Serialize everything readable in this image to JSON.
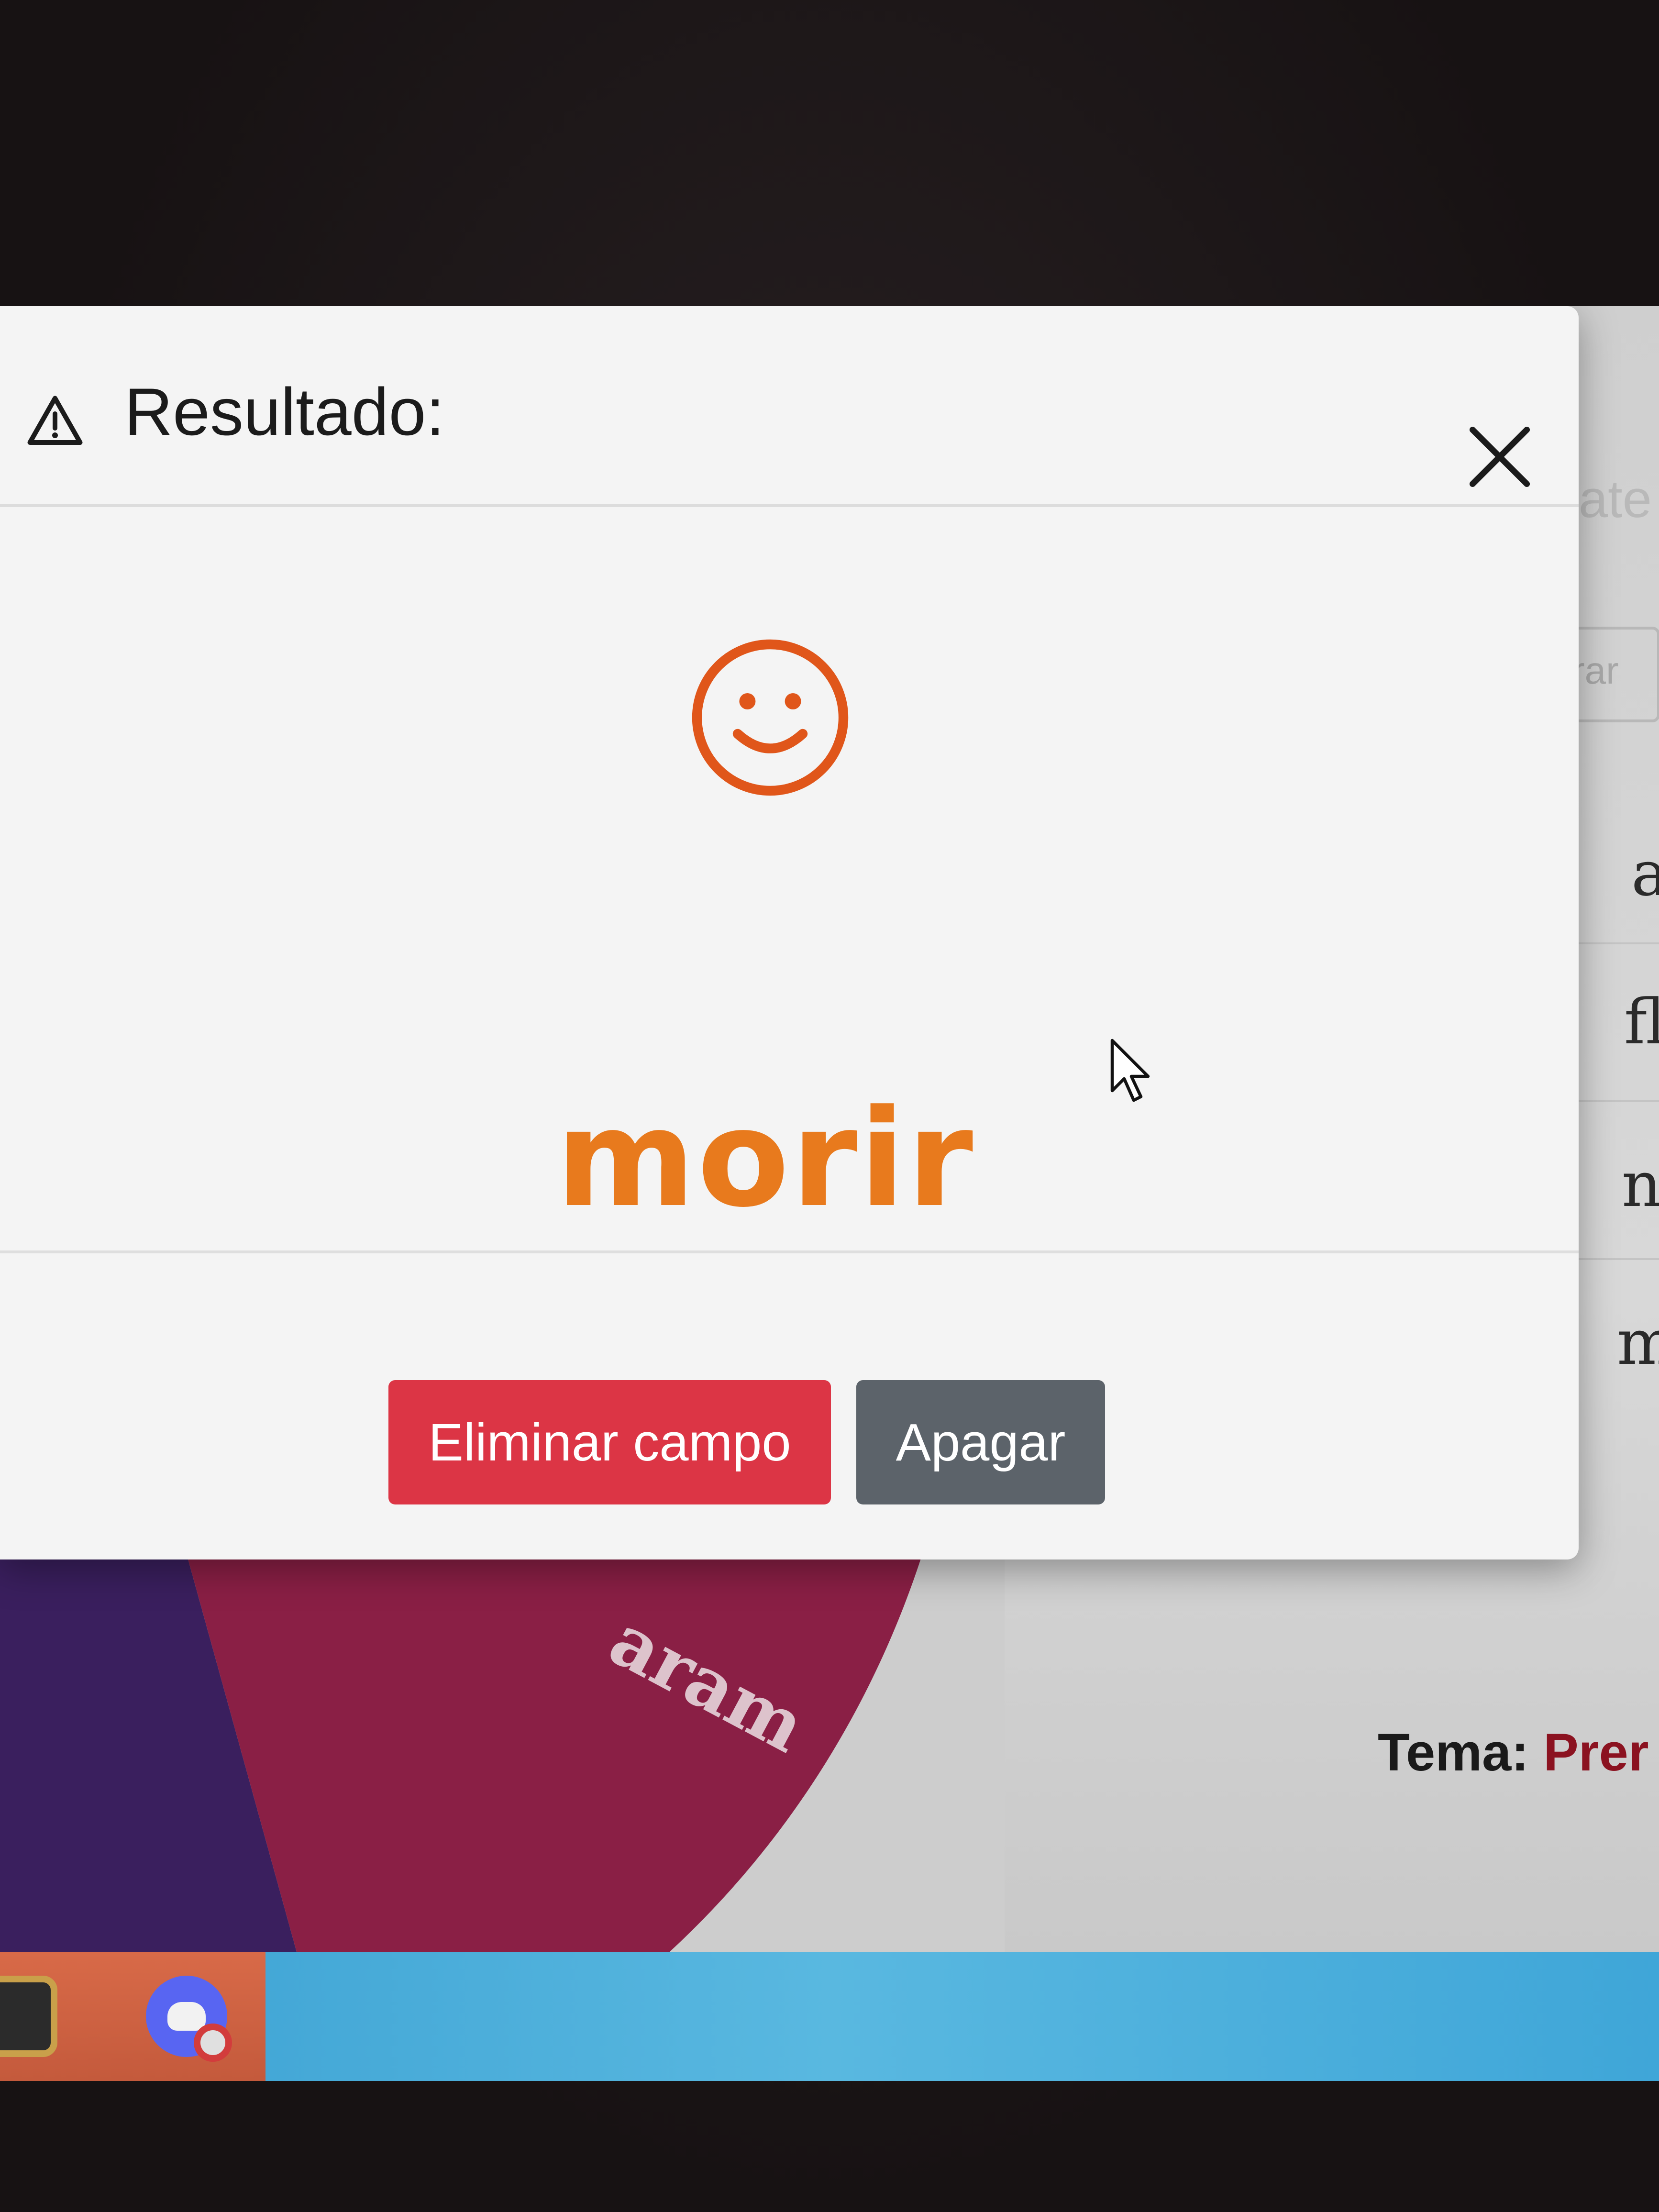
{
  "modal": {
    "title": "Resultado:",
    "result_word": "morir",
    "buttons": {
      "delete_label": "Eliminar campo",
      "off_label": "Apagar"
    },
    "icons": {
      "header": "warning-triangle-icon",
      "close": "close-icon",
      "result": "smiley-icon"
    },
    "colors": {
      "accent": "#e87a1d",
      "danger": "#dc3545",
      "secondary": "#5c636a"
    }
  },
  "background": {
    "wheel_label": "aram",
    "theme_label": "Tema:",
    "theme_value": "Prer",
    "header_fragment": "ate",
    "button_fragment": "rar",
    "list_fragments": [
      "a",
      "fl",
      "n",
      "m"
    ]
  },
  "taskbar": {
    "icons": [
      "league-of-legends-icon",
      "discord-icon"
    ]
  }
}
